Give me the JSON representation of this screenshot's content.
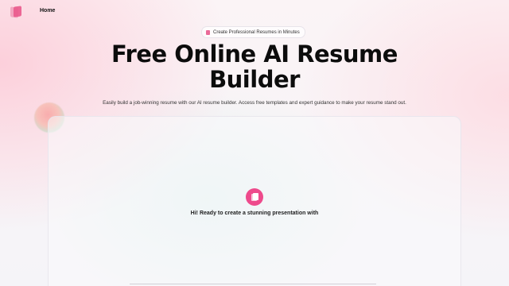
{
  "nav": {
    "home_label": "Home"
  },
  "hero": {
    "badge_text": "Create Professional Resumes in Minutes",
    "title_line1": "Free Online AI Resume",
    "title_line2": "Builder",
    "subtitle": "Easily build a job-winning resume with our AI resume builder. Access free templates and expert guidance to make your resume stand out."
  },
  "chat": {
    "greeting": "Hi! Ready to create a stunning presentation with"
  },
  "colors": {
    "accent": "#ee4a8c",
    "title": "#0c0c0c"
  },
  "icons": {
    "brand": "logo-icon",
    "badge": "document-icon",
    "assistant": "assistant-logo-icon"
  }
}
